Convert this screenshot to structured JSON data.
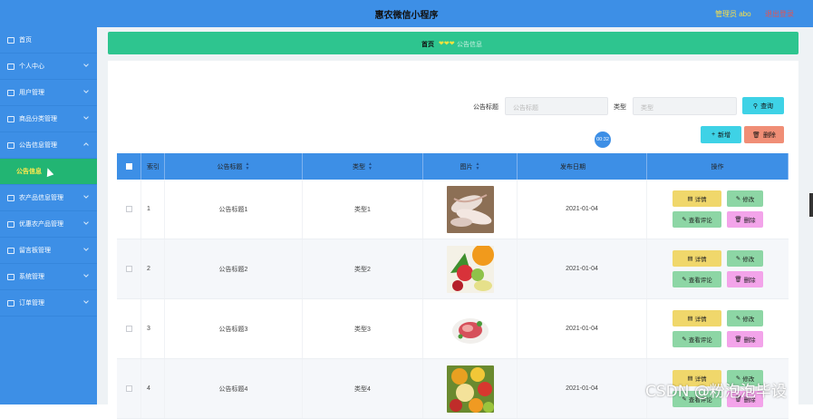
{
  "header": {
    "title": "惠农微信小程序",
    "admin": "管理员 abo",
    "logout": "退出登录"
  },
  "sidebar": {
    "items": [
      {
        "label": "首页",
        "icon": "home-icon"
      },
      {
        "label": "个人中心",
        "icon": "user-icon"
      },
      {
        "label": "用户管理",
        "icon": "users-icon"
      },
      {
        "label": "商品分类管理",
        "icon": "folder-icon"
      },
      {
        "label": "公告信息管理",
        "icon": "notice-icon"
      },
      {
        "label": "公告信息",
        "icon": "cursor-icon"
      },
      {
        "label": "农产品信息管理",
        "icon": "list-icon"
      },
      {
        "label": "优惠农产品管理",
        "icon": "list-icon"
      },
      {
        "label": "留言板管理",
        "icon": "message-icon"
      },
      {
        "label": "系统管理",
        "icon": "settings-icon"
      },
      {
        "label": "订单管理",
        "icon": "order-icon"
      }
    ]
  },
  "breadcrumb": {
    "home": "首页",
    "separator": "❤❤❤",
    "current": "公告信息"
  },
  "search": {
    "title_label": "公告标题",
    "title_placeholder": "公告标题",
    "type_label": "类型",
    "type_placeholder": "类型",
    "search_button": "查询"
  },
  "toolbar": {
    "add_button": "新增",
    "delete_button": "删除"
  },
  "table": {
    "headers": [
      "索引",
      "公告标题",
      "类型",
      "图片",
      "发布日期",
      "操作"
    ],
    "rows": [
      {
        "index": "1",
        "title": "公告标题1",
        "type": "类型1",
        "date": "2021-01-04"
      },
      {
        "index": "2",
        "title": "公告标题2",
        "type": "类型2",
        "date": "2021-01-04"
      },
      {
        "index": "3",
        "title": "公告标题3",
        "type": "类型3",
        "date": "2021-01-04"
      },
      {
        "index": "4",
        "title": "公告标题4",
        "type": "类型4",
        "date": "2021-01-04"
      }
    ],
    "actions": {
      "detail": "详情",
      "edit": "修改",
      "review": "查看评论",
      "remove": "删除"
    }
  },
  "timer": "00:32",
  "watermark": "CSDN @粉泡泡毕设",
  "colors": {
    "primary": "#3d8fe6",
    "breadcrumb": "#2ec58f",
    "active_menu": "#22b573",
    "cyan": "#3ed2e6",
    "danger": "#f08e76"
  }
}
